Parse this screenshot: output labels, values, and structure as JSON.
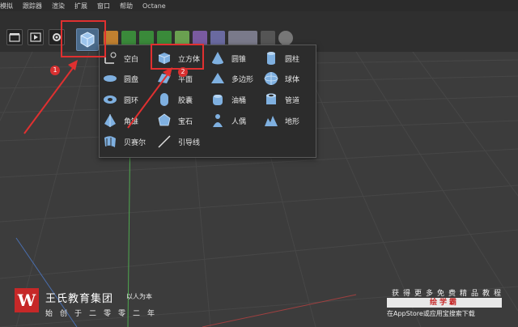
{
  "menubar": {
    "items": [
      "模拟",
      "跟踪器",
      "渲染",
      "扩展",
      "窗口",
      "帮助",
      "Octane"
    ]
  },
  "menu": {
    "columns": [
      [
        {
          "label": "空白",
          "icon": "null-icon"
        },
        {
          "label": "圆盘",
          "icon": "disc-icon"
        },
        {
          "label": "圆环",
          "icon": "torus-icon"
        },
        {
          "label": "角锥",
          "icon": "pyramid-icon"
        },
        {
          "label": "贝赛尔",
          "icon": "bezier-icon"
        }
      ],
      [
        {
          "label": "立方体",
          "icon": "cube-icon"
        },
        {
          "label": "平面",
          "icon": "plane-icon"
        },
        {
          "label": "胶囊",
          "icon": "capsule-icon"
        },
        {
          "label": "宝石",
          "icon": "gem-icon"
        },
        {
          "label": "引导线",
          "icon": "guide-icon"
        }
      ],
      [
        {
          "label": "圆锥",
          "icon": "cone-icon"
        },
        {
          "label": "多边形",
          "icon": "polygon-icon"
        },
        {
          "label": "油桶",
          "icon": "oil-tank-icon"
        },
        {
          "label": "人偶",
          "icon": "figure-icon"
        }
      ],
      [
        {
          "label": "圆柱",
          "icon": "cylinder-icon"
        },
        {
          "label": "球体",
          "icon": "sphere-icon"
        },
        {
          "label": "管道",
          "icon": "tube-icon"
        },
        {
          "label": "地形",
          "icon": "landscape-icon"
        }
      ]
    ]
  },
  "annotations": {
    "badge1": "1",
    "badge2": "2"
  },
  "watermark": {
    "logo_letter": "W",
    "brand": "王氏教育集团",
    "slogan": "以人为本",
    "sub": "始创于二零零二年",
    "promo_line1": "获得更多免费精品教程",
    "promo_highlight": "绘学霸",
    "promo_line3": "在AppStore或应用宝搜索下载"
  },
  "colors": {
    "accent": "#e03030",
    "icon_blue": "#7fb0e0",
    "panel_bg": "#2c2c2c"
  }
}
